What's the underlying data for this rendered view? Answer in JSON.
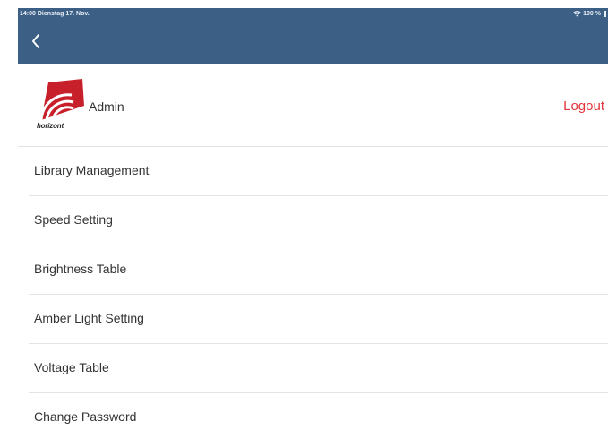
{
  "status_bar": {
    "time_date": "14:00 Dienstag 17. Nov.",
    "battery": "100 %"
  },
  "header": {
    "logo_text": "horizont",
    "user_name": "Admin",
    "logout_label": "Logout"
  },
  "menu": {
    "items": [
      {
        "label": "Library Management"
      },
      {
        "label": "Speed Setting"
      },
      {
        "label": "Brightness Table"
      },
      {
        "label": "Amber Light Setting"
      },
      {
        "label": "Voltage Table"
      },
      {
        "label": "Change Password"
      }
    ]
  },
  "colors": {
    "navbar": "#3c5f86",
    "logout": "#e1333a",
    "logo_red": "#c8202a"
  }
}
